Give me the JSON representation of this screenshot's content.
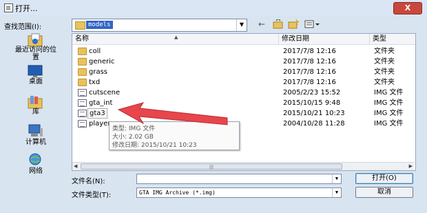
{
  "window": {
    "title": "打开...",
    "close_label": "X"
  },
  "lookin": {
    "label": "查找范围(I):",
    "value": "models"
  },
  "places": [
    {
      "label_line1": "最近访问的位",
      "label_line2": "置"
    },
    {
      "label_line1": "桌面",
      "label_line2": ""
    },
    {
      "label_line1": "库",
      "label_line2": ""
    },
    {
      "label_line1": "计算机",
      "label_line2": ""
    },
    {
      "label_line1": "网络",
      "label_line2": ""
    }
  ],
  "columns": {
    "name": "名称",
    "date": "修改日期",
    "type": "类型"
  },
  "files": [
    {
      "name": "coll",
      "date": "2017/7/8 12:16",
      "type": "文件夹",
      "kind": "folder"
    },
    {
      "name": "generic",
      "date": "2017/7/8 12:16",
      "type": "文件夹",
      "kind": "folder"
    },
    {
      "name": "grass",
      "date": "2017/7/8 12:16",
      "type": "文件夹",
      "kind": "folder"
    },
    {
      "name": "txd",
      "date": "2017/7/8 12:16",
      "type": "文件夹",
      "kind": "folder"
    },
    {
      "name": "cutscene",
      "date": "2005/2/23 15:52",
      "type": "IMG 文件",
      "kind": "file"
    },
    {
      "name": "gta_int",
      "date": "2015/10/15 9:48",
      "type": "IMG 文件",
      "kind": "file"
    },
    {
      "name": "gta3",
      "date": "2015/10/21 10:23",
      "type": "IMG 文件",
      "kind": "file"
    },
    {
      "name": "player",
      "date": "2004/10/28 11:28",
      "type": "IMG 文件",
      "kind": "file"
    }
  ],
  "tooltip": {
    "type_line": "类型: IMG 文件",
    "size_line": "大小: 2.02 GB",
    "date_line": "修改日期: 2015/10/21 10:23"
  },
  "filename": {
    "label": "文件名(N):",
    "value": ""
  },
  "filetype": {
    "label": "文件类型(T):",
    "value": "GTA IMG Archive (*.img)"
  },
  "buttons": {
    "open": "打开(O)",
    "cancel": "取消"
  },
  "colors": {
    "accent_selection": "#3165c4",
    "arrow": "#e8454c",
    "close_button": "#c9483e"
  }
}
